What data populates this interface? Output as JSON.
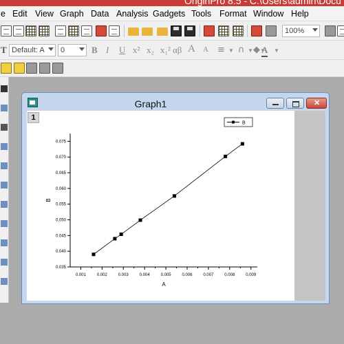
{
  "app": {
    "title": "OriginPro 8.5 - C:\\Users\\admin\\Docu"
  },
  "menu": [
    "e",
    "Edit",
    "View",
    "Graph",
    "Data",
    "Analysis",
    "Gadgets",
    "Tools",
    "Format",
    "Window",
    "Help"
  ],
  "toolbar": {
    "zoom_value": "100%",
    "font_value": "Default: A",
    "size_value": "0",
    "format_labels": [
      "B",
      "I",
      "U",
      "x²",
      "x₂",
      "x₁²",
      "αβ",
      "A",
      "A"
    ]
  },
  "graph_window": {
    "title": "Graph1",
    "layer_label": "1"
  },
  "chart_data": {
    "type": "line",
    "x": [
      0.0016,
      0.0026,
      0.0029,
      0.0038,
      0.0054,
      0.0078,
      0.0086
    ],
    "series": [
      {
        "name": "B",
        "y": [
          0.039,
          0.044,
          0.0454,
          0.0499,
          0.0576,
          0.0702,
          0.0742
        ]
      }
    ],
    "xlabel": "A",
    "ylabel": "B",
    "xlim": [
      0.0005,
      0.0093
    ],
    "ylim": [
      0.035,
      0.0775
    ],
    "xticks": [
      "0.001",
      "0.002",
      "0.003",
      "0.004",
      "0.005",
      "0.006",
      "0.007",
      "0.008",
      "0.009"
    ],
    "yticks": [
      "0.035",
      "0.040",
      "0.045",
      "0.050",
      "0.055",
      "0.060",
      "0.065",
      "0.070",
      "0.075"
    ],
    "marker": "square",
    "legend": "top-right",
    "grid": false,
    "line_color": "#000000"
  }
}
